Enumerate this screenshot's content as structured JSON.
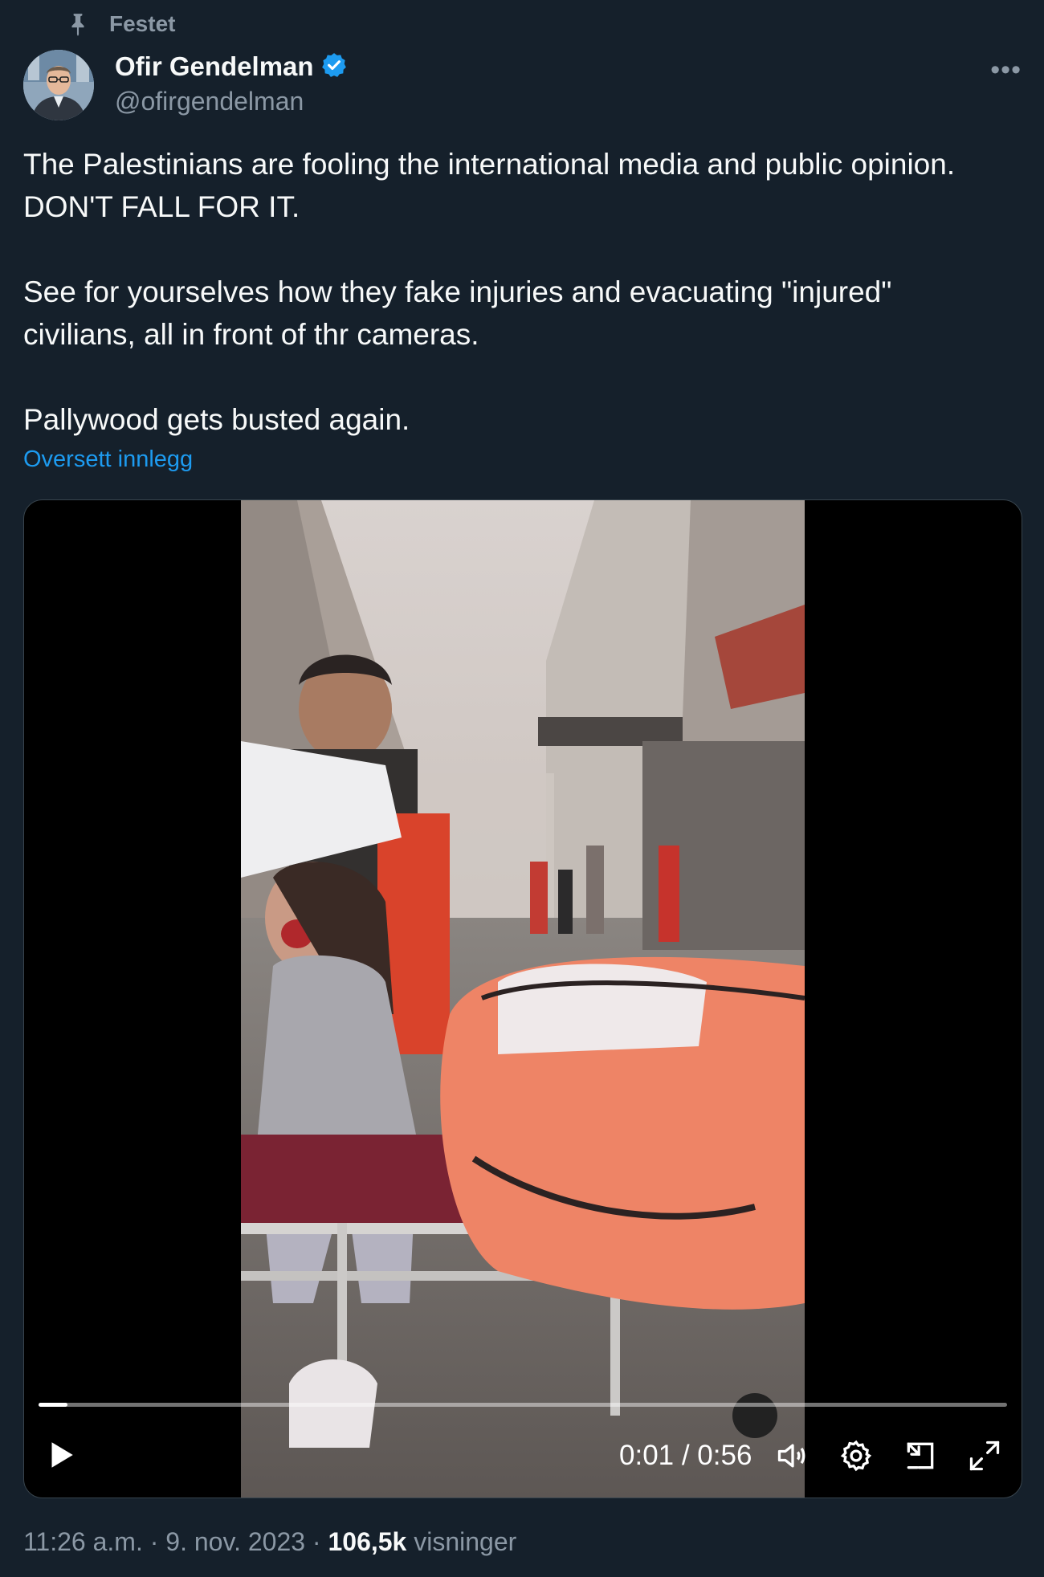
{
  "pinned": {
    "label": "Festet",
    "icon": "pin-icon"
  },
  "author": {
    "name": "Ofir Gendelman",
    "handle": "@ofirgendelman",
    "verified_color": "#1d9bf0"
  },
  "tweet": {
    "paragraphs": [
      "The Palestinians are fooling the international media and public opinion.",
      "DON'T FALL FOR IT.",
      "",
      "See for yourselves how they fake injuries and evacuating \"injured\"",
      "civilians, all in front of thr cameras.",
      "",
      "Pallywood gets busted again."
    ],
    "translate": "Oversett innlegg"
  },
  "video": {
    "time": "0:01 / 0:56",
    "progress": 0.03
  },
  "meta": {
    "time": "11:26 a.m.",
    "date": "9. nov. 2023",
    "views_count": "106,5k",
    "views_label": "visninger",
    "sep": " · "
  },
  "colors": {
    "background": "#15202b",
    "secondary_text": "#8b98a5",
    "link": "#1d9bf0"
  }
}
